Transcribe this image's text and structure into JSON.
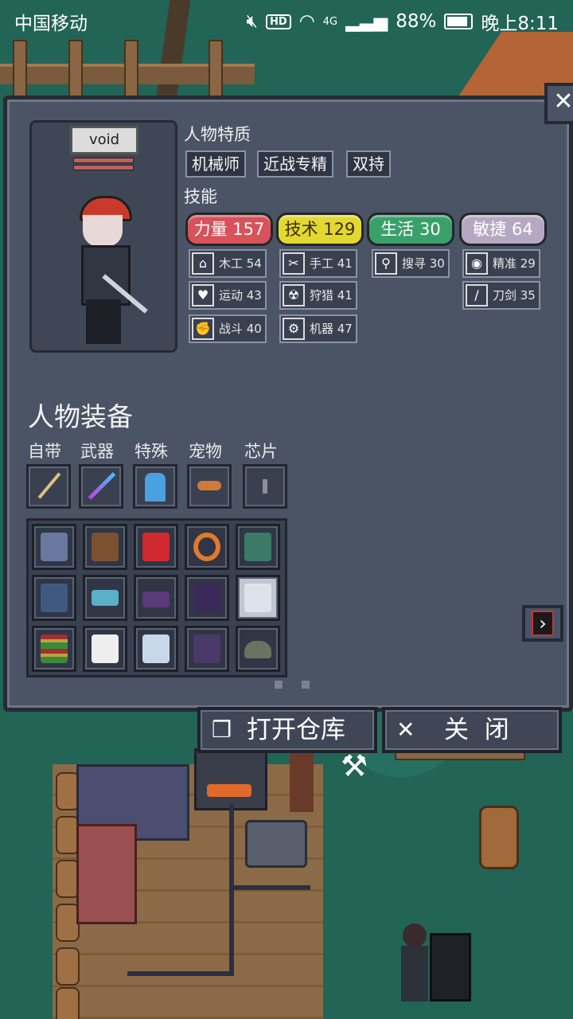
{
  "status_bar": {
    "carrier": "中国移动",
    "hd": "HD",
    "network": "4G",
    "battery": "88%",
    "time": "晚上8:11"
  },
  "character": {
    "name": "void"
  },
  "traits": {
    "title": "人物特质",
    "items": [
      "机械师",
      "近战专精",
      "双持"
    ]
  },
  "skills": {
    "title": "技能",
    "stats": [
      {
        "label": "力量 157",
        "color": "#d8525a"
      },
      {
        "label": "技术 129",
        "color": "#e2d832"
      },
      {
        "label": "生活 30",
        "color": "#3aa06a"
      },
      {
        "label": "敏捷 64",
        "color": "#b6a8c2"
      }
    ],
    "sub": [
      {
        "label": "木工 54",
        "icon": "house-icon",
        "glyph": "⌂"
      },
      {
        "label": "运动 43",
        "icon": "heart-icon",
        "glyph": "♥"
      },
      {
        "label": "战斗 40",
        "icon": "fist-icon",
        "glyph": "✊"
      },
      {
        "label": "手工 41",
        "icon": "scissors-icon",
        "glyph": "✂"
      },
      {
        "label": "狩猎 41",
        "icon": "radiation-icon",
        "glyph": "☢"
      },
      {
        "label": "机器 47",
        "icon": "gear-icon",
        "glyph": "⚙"
      },
      {
        "label": "搜寻 30",
        "icon": "magnifier-icon",
        "glyph": "⚲"
      },
      {
        "label": "精准 29",
        "icon": "eye-icon",
        "glyph": "◉"
      },
      {
        "label": "刀剑 35",
        "icon": "blade-icon",
        "glyph": "/"
      }
    ]
  },
  "equipment": {
    "title": "人物装备",
    "slots": [
      "自带",
      "武器",
      "特殊",
      "宠物",
      "芯片"
    ]
  },
  "buttons": {
    "open_storage": "打开仓库",
    "close": "关  闭"
  },
  "colors": {
    "panel": "#4a5465",
    "border": "#252a33",
    "grass": "#226456"
  }
}
